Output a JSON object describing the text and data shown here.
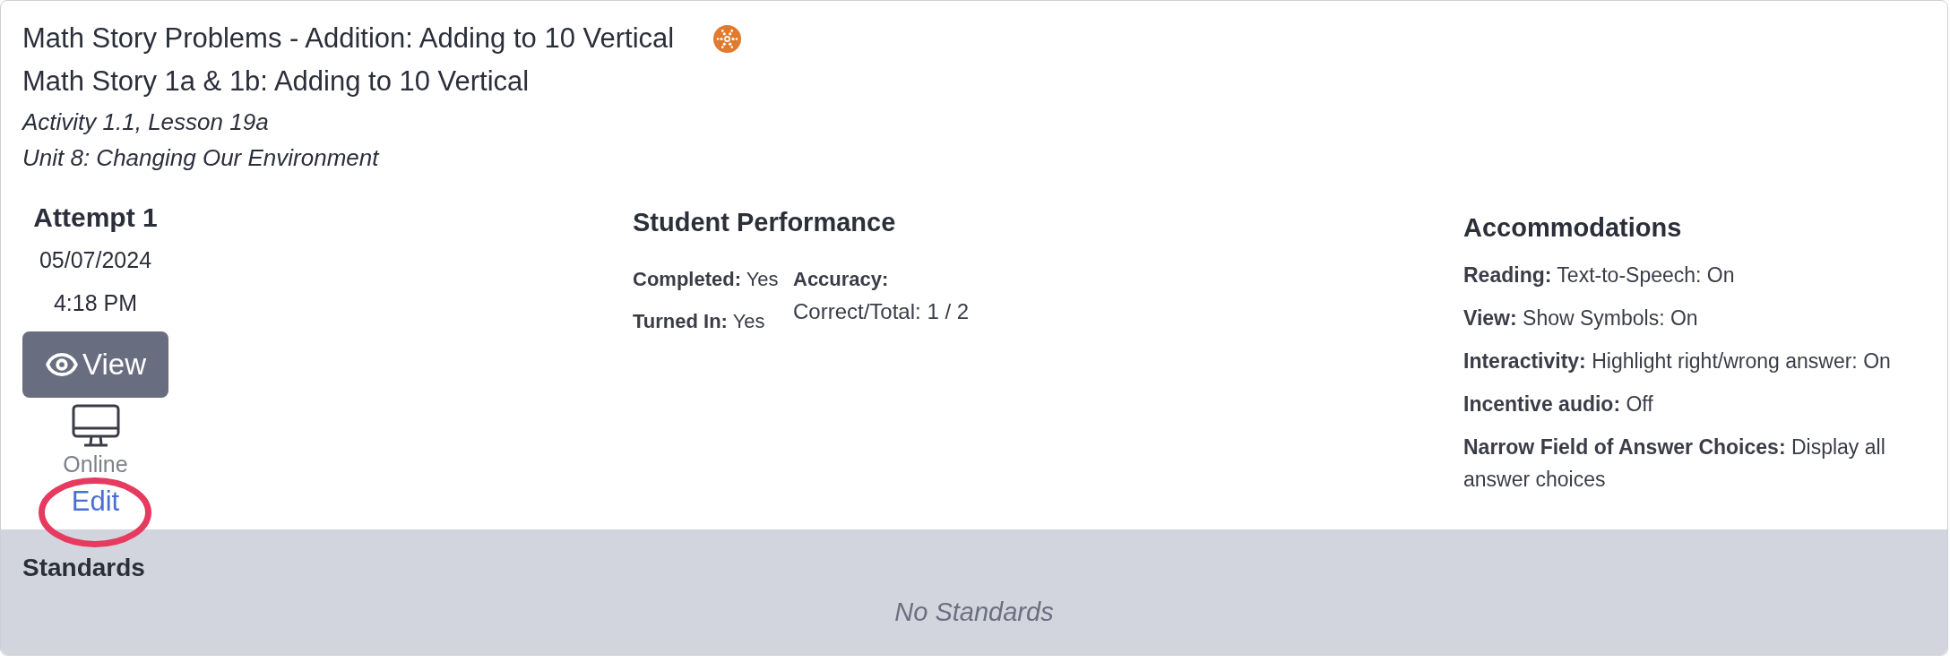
{
  "activity": {
    "title": "Math Story Problems - Addition: Adding to 10 Vertical",
    "subtitle": "Math Story 1a & 1b: Adding to 10 Vertical",
    "activity_lesson": "Activity 1.1, Lesson 19a",
    "unit": "Unit 8: Changing Our Environment"
  },
  "attempt": {
    "title": "Attempt 1",
    "date": "05/07/2024",
    "time": "4:18 PM",
    "view_button": "View",
    "mode": "Online",
    "edit_link": "Edit"
  },
  "student_performance": {
    "title": "Student Performance",
    "status": [
      "**Completed:** Yes",
      "**Turned In:** Yes"
    ],
    "accuracy": {
      "label": "Accuracy:",
      "value": "Correct/Total: 1 / 2"
    }
  },
  "accommodations": {
    "title": "Accommodations",
    "items": [
      "**Reading:** Text-to-Speech: On",
      "**View:** Show Symbols: On",
      "**Interactivity:** Highlight right/wrong answer: On",
      "**Incentive audio:** Off",
      "**Narrow Field of Answer Choices:** Display all answer choices"
    ]
  },
  "standards": {
    "title": "Standards",
    "empty_message": "No Standards"
  }
}
